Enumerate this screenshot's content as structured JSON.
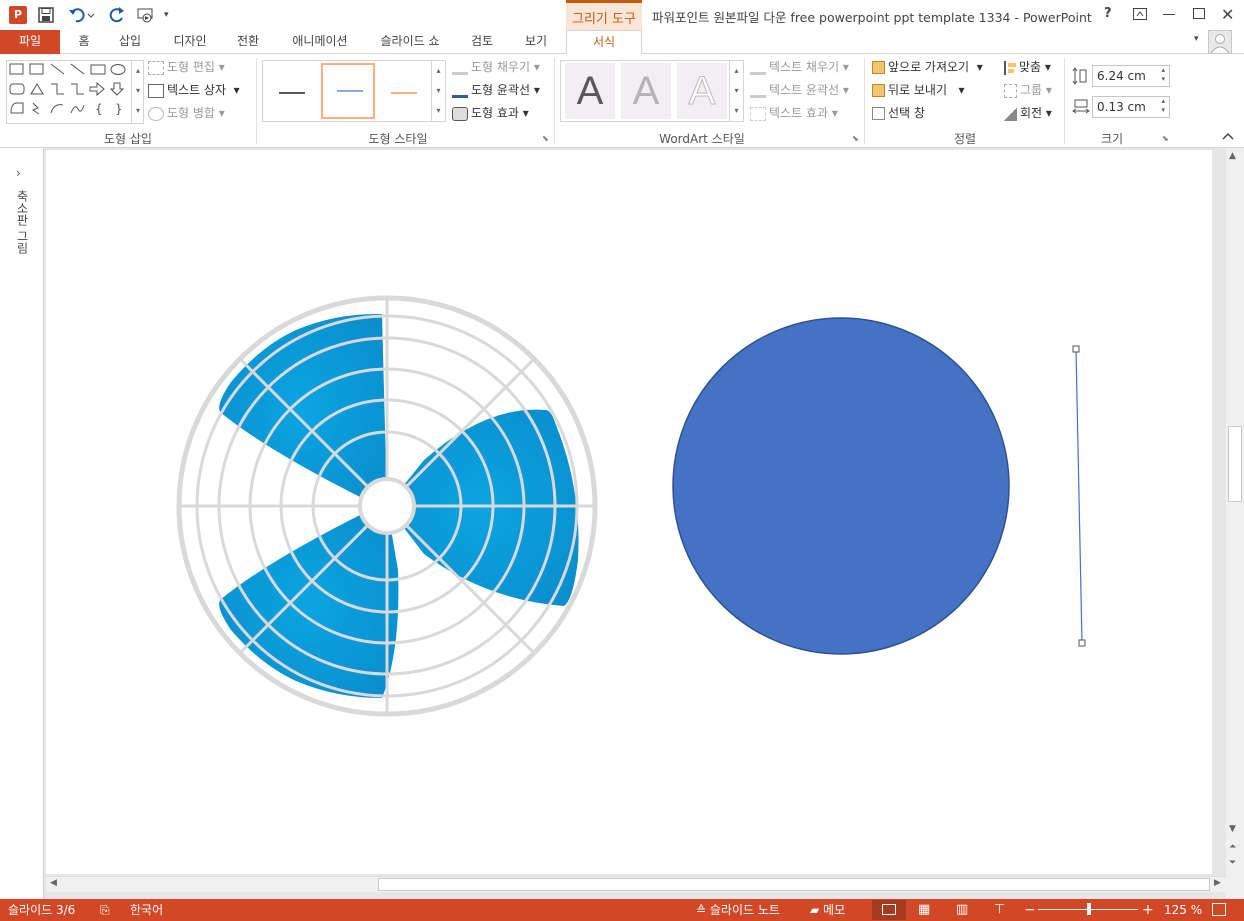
{
  "title_bar": {
    "app_icon": "powerpoint-logo",
    "contextual_tab_group": "그리기 도구",
    "window_title": "파워포인트 원본파일 다운 free powerpoint ppt template 1334 - PowerPoint",
    "help": "?",
    "colors": {
      "accent": "#d24726",
      "contextual": "#c55a11"
    }
  },
  "tabs": {
    "file": "파일",
    "home": "홈",
    "insert": "삽입",
    "design": "디자인",
    "transitions": "전환",
    "animations": "애니메이션",
    "slideshow": "슬라이드 쇼",
    "review": "검토",
    "view": "보기",
    "format": "서식"
  },
  "ribbon": {
    "insert_shapes": {
      "label": "도형 삽입",
      "edit_shape": "도형 편집",
      "text_box": "텍스트 상자",
      "merge_shapes": "도형 병합"
    },
    "shape_styles": {
      "label": "도형 스타일",
      "fill": "도형 채우기",
      "outline": "도형 윤곽선",
      "effects": "도형 효과",
      "swatches": [
        "#595959",
        "#8eaadb",
        "#f4b183"
      ]
    },
    "wordart": {
      "label": "WordArt 스타일",
      "letter": "A",
      "text_fill": "텍스트 채우기",
      "text_outline": "텍스트 윤곽선",
      "text_effects": "텍스트 효과"
    },
    "arrange": {
      "label": "정렬",
      "bring_forward": "앞으로 가져오기",
      "send_backward": "뒤로 보내기",
      "selection_pane": "선택 창",
      "align": "맞춤",
      "group": "그룹",
      "rotate": "회전"
    },
    "size": {
      "label": "크기",
      "height": "6.24 cm",
      "width": "0.13 cm"
    }
  },
  "thumbnail_pane": {
    "label": "축소판 그림"
  },
  "slide": {
    "fan_color": "#0aa5e2",
    "circle_color": "#4472c4"
  },
  "status_bar": {
    "slide_indicator": "슬라이드 3/6",
    "language": "한국어",
    "notes": "슬라이드 노트",
    "comments": "메모",
    "zoom": "125 %"
  }
}
